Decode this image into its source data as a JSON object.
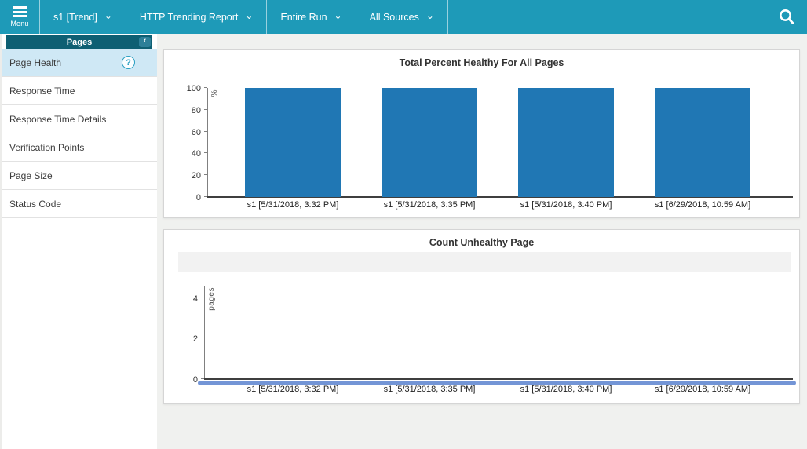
{
  "topbar": {
    "menu_label": "Menu",
    "dropdowns": [
      {
        "label": "s1 [Trend]"
      },
      {
        "label": "HTTP Trending Report"
      },
      {
        "label": "Entire Run"
      },
      {
        "label": "All Sources"
      }
    ],
    "icons": {
      "menu": "hamburger-icon",
      "search": "search-icon",
      "dropdown": "chevron-down-icon"
    },
    "colors": {
      "bg": "#1e9ab8",
      "text": "#ffffff"
    }
  },
  "sidebar": {
    "header": {
      "title": "Pages",
      "collapse_icon": "chevron-left-icon"
    },
    "items": [
      {
        "label": "Page Health",
        "selected": true,
        "has_help_icon": true
      },
      {
        "label": "Response Time",
        "selected": false
      },
      {
        "label": "Response Time Details",
        "selected": false
      },
      {
        "label": "Verification Points",
        "selected": false
      },
      {
        "label": "Page Size",
        "selected": false
      },
      {
        "label": "Status Code",
        "selected": false
      }
    ],
    "help_icon_glyph": "?",
    "colors": {
      "header_bg": "#0e5f73",
      "selected_bg": "#cfe8f5"
    }
  },
  "chart_data": [
    {
      "type": "bar",
      "title": "Total Percent Healthy For All Pages",
      "ylabel": "%",
      "xlabel": "",
      "categories": [
        "s1 [5/31/2018, 3:32 PM]",
        "s1 [5/31/2018, 3:35 PM]",
        "s1 [5/31/2018, 3:40 PM]",
        "s1 [6/29/2018, 10:59 AM]"
      ],
      "values": [
        100,
        100,
        100,
        100
      ],
      "ylim": [
        0,
        100
      ],
      "yticks": [
        0,
        20,
        40,
        60,
        80,
        100
      ],
      "bar_color": "#2077b4",
      "grid": false,
      "legend": "none"
    },
    {
      "type": "line",
      "title": "Count Unhealthy Page",
      "ylabel": "pages",
      "xlabel": "",
      "categories": [
        "s1 [5/31/2018, 3:32 PM]",
        "s1 [5/31/2018, 3:35 PM]",
        "s1 [5/31/2018, 3:40 PM]",
        "s1 [6/29/2018, 10:59 AM]"
      ],
      "values": [
        0,
        0,
        0,
        0
      ],
      "ylim": [
        0,
        4.6
      ],
      "yticks": [
        0,
        2,
        4
      ],
      "line_color": "#7395d6",
      "legend_band_empty": true,
      "grid": false,
      "legend": "none"
    }
  ]
}
